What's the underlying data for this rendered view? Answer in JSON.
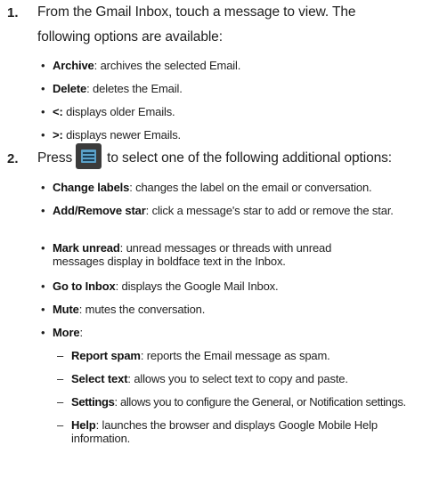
{
  "steps": [
    {
      "number": "1.",
      "line1": "From the Gmail Inbox, touch a message to view. The",
      "line2": "following options are available:",
      "bullets": [
        {
          "term": "Archive",
          "desc": ": archives the selected Email."
        },
        {
          "term": "Delete",
          "desc": ": deletes the Email."
        },
        {
          "term": "<:",
          "desc": " displays older Emails."
        },
        {
          "term": ">:",
          "desc": " displays newer Emails."
        }
      ]
    },
    {
      "number": "2.",
      "text_before_icon": "Press",
      "icon": "menu-key-icon",
      "text_after_icon": "to select one of the following additional options:",
      "bullets": [
        {
          "term": "Change labels",
          "desc": ": changes the label on the email or conversation."
        },
        {
          "term": "Add/Remove star",
          "desc": ": click a message's star to add or remove the star."
        },
        {
          "term": "Mark unread",
          "desc": ": unread messages or threads with unread messages display in boldface text in the Inbox."
        },
        {
          "term": "Go to Inbox",
          "desc": ": displays the Google Mail Inbox."
        },
        {
          "term": "Mute",
          "desc": ": mutes the conversation."
        },
        {
          "term": "More",
          "desc": ":"
        }
      ],
      "more_items": [
        {
          "term": "Report spam",
          "desc": ": reports the Email message as spam."
        },
        {
          "term": "Select text",
          "desc": ": allows you to select text to copy and paste."
        },
        {
          "term": "Settings",
          "desc": ": allows you to configure the General, or Notification settings."
        },
        {
          "term": "Help",
          "desc": ": launches the browser and displays Google Mobile Help information."
        }
      ]
    }
  ]
}
